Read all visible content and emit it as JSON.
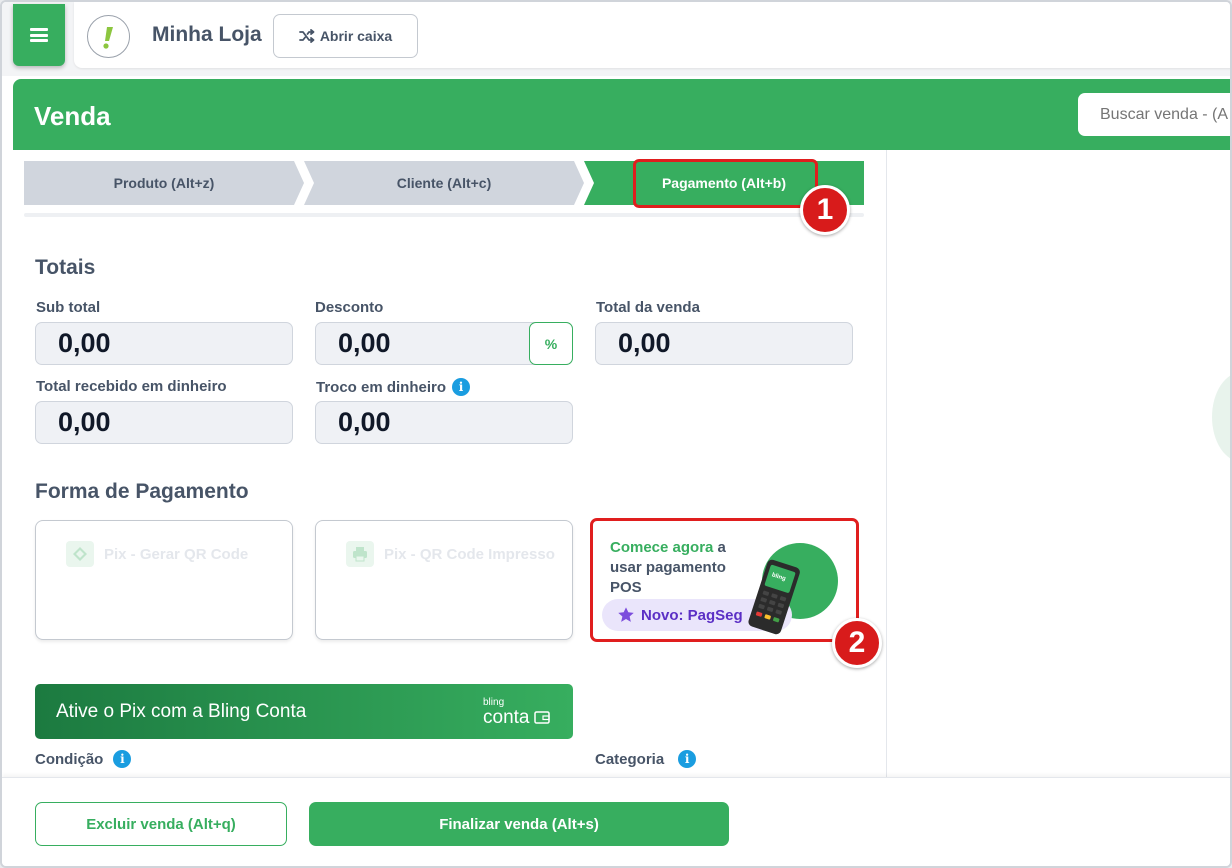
{
  "topbar": {
    "store_name": "Minha Loja",
    "open_box_label": "Abrir caixa"
  },
  "header": {
    "title": "Venda",
    "search_placeholder": "Buscar venda - (A"
  },
  "steps": [
    {
      "label": "Produto (Alt+z)",
      "active": false
    },
    {
      "label": "Cliente (Alt+c)",
      "active": false
    },
    {
      "label": "Pagamento (Alt+b)",
      "active": true
    }
  ],
  "totals": {
    "title": "Totais",
    "subtotal_label": "Sub total",
    "subtotal_value": "0,00",
    "discount_label": "Desconto",
    "discount_value": "0,00",
    "discount_btn": "%",
    "total_label": "Total da venda",
    "total_value": "0,00",
    "cash_label": "Total recebido em dinheiro",
    "cash_value": "0,00",
    "change_label": "Troco em dinheiro",
    "change_value": "0,00"
  },
  "payment": {
    "title": "Forma de Pagamento",
    "methods": [
      {
        "label": "Pix - Gerar QR Code",
        "icon": "pix-icon"
      },
      {
        "label": "Pix - QR Code Impresso",
        "icon": "printer-icon"
      }
    ],
    "promo": {
      "highlight": "Comece agora",
      "text_a": " a",
      "text_b": "usar pagamento POS",
      "pill": "Novo: PagSeg",
      "device_brand": "bling"
    }
  },
  "pix_banner": {
    "text": "Ative o Pix com a Bling Conta",
    "brand_top": "bling",
    "brand_bottom": "conta"
  },
  "fields": {
    "condition_label": "Condição",
    "category_label": "Categoria"
  },
  "footer": {
    "delete_label": "Excluir venda (Alt+q)",
    "finish_label": "Finalizar venda (Alt+s)"
  },
  "annotations": {
    "badge_1": "1",
    "badge_2": "2"
  },
  "colors": {
    "brand_green": "#37ae5f",
    "highlight_red": "#e01e1e",
    "promo_purple": "#5b2fc5",
    "info_blue": "#1a9de0"
  }
}
